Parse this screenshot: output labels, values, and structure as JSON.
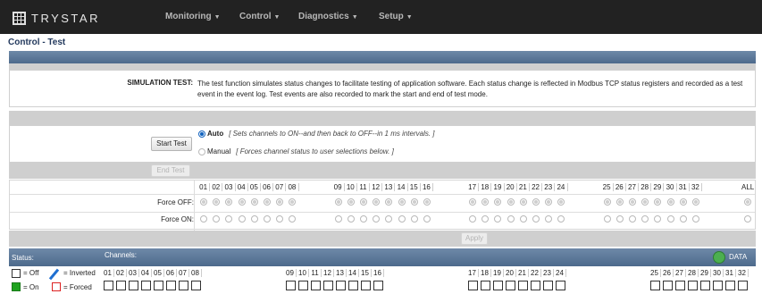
{
  "brand": {
    "name": "TRYSTAR"
  },
  "nav": {
    "items": [
      "Monitoring",
      "Control",
      "Diagnostics",
      "Setup"
    ]
  },
  "page_title": "Control - Test",
  "simulation": {
    "label": "SIMULATION TEST:",
    "text": "The test function simulates status changes to facilitate testing of application software. Each status change is reflected in Modbus TCP status registers and recorded as a test event in the event log. Test events are also recorded to mark the start and end of test mode."
  },
  "controls": {
    "start_test": "Start Test",
    "end_test": "End Test",
    "apply": "Apply",
    "auto_label": "Auto",
    "auto_desc": "[ Sets channels to ON--and then back to OFF--in 1 ms intervals. ]",
    "manual_label": "Manual",
    "manual_desc": "[ Forces channel status to user selections below. ]",
    "selected_mode": "Auto",
    "force_off": "Force OFF:",
    "force_on": "Force ON:",
    "all": "ALL"
  },
  "channel_groups": [
    [
      "01",
      "02",
      "03",
      "04",
      "05",
      "06",
      "07",
      "08"
    ],
    [
      "09",
      "10",
      "11",
      "12",
      "13",
      "14",
      "15",
      "16"
    ],
    [
      "17",
      "18",
      "19",
      "20",
      "21",
      "22",
      "23",
      "24"
    ],
    [
      "25",
      "26",
      "27",
      "28",
      "29",
      "30",
      "31",
      "32"
    ]
  ],
  "status": {
    "status_label": "Status:",
    "channels_label": "Channels:",
    "data_label": "DATA",
    "data_color": "#4caf50",
    "legend_off": "= Off",
    "legend_inverted": "= Inverted",
    "legend_on": "= On",
    "legend_forced": "= Forced",
    "on_color": "#1fa31f",
    "forced_color": "#d22"
  },
  "colors": {
    "nav_bg": "#222222",
    "header_bar": "#5b7898",
    "title": "#23395d"
  }
}
